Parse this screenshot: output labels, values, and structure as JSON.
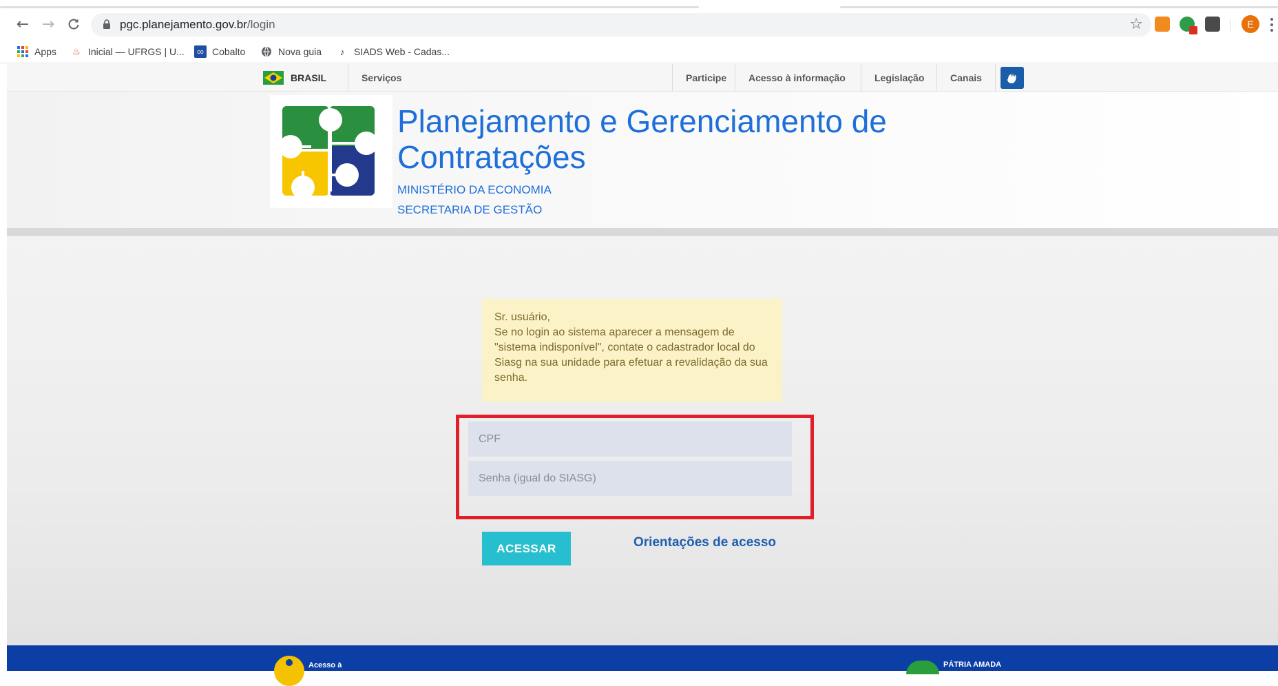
{
  "browser": {
    "url_host": "pgc.planejamento.gov.br",
    "url_path": "/login",
    "profile_initial": "E",
    "bookmarks": [
      {
        "label": "Apps"
      },
      {
        "label": "Inicial — UFRGS | U..."
      },
      {
        "label": "Cobalto"
      },
      {
        "label": "Nova guia"
      },
      {
        "label": "SIADS Web - Cadas..."
      }
    ]
  },
  "govbar": {
    "brasil": "BRASIL",
    "servicos": "Serviços",
    "items": [
      "Participe",
      "Acesso à informação",
      "Legislação",
      "Canais"
    ]
  },
  "header": {
    "title_line1": "Planejamento e Gerenciamento de",
    "title_line2": "Contratações",
    "ministry": "MINISTÉRIO DA ECONOMIA",
    "secretariat": "SECRETARIA DE GESTÃO"
  },
  "notice": {
    "line1": "Sr. usuário,",
    "line2": "Se no login ao sistema aparecer a mensagem de \"sistema indisponível\", contate o cadastrador local do Siasg na sua unidade para efetuar a revalidação da sua senha."
  },
  "form": {
    "cpf_placeholder": "CPF",
    "password_placeholder": "Senha (igual do SIASG)",
    "submit_label": "ACESSAR",
    "help_link": "Orientações de acesso"
  },
  "footer": {
    "acesso_label": "Acesso à",
    "patria_label": "PÁTRIA AMADA"
  },
  "colors": {
    "title_blue": "#1e6fd9",
    "button_teal": "#27bfcf",
    "highlight_red": "#e31e2b",
    "notice_bg": "#fcf2c8",
    "footer_blue": "#0b3fa6"
  }
}
